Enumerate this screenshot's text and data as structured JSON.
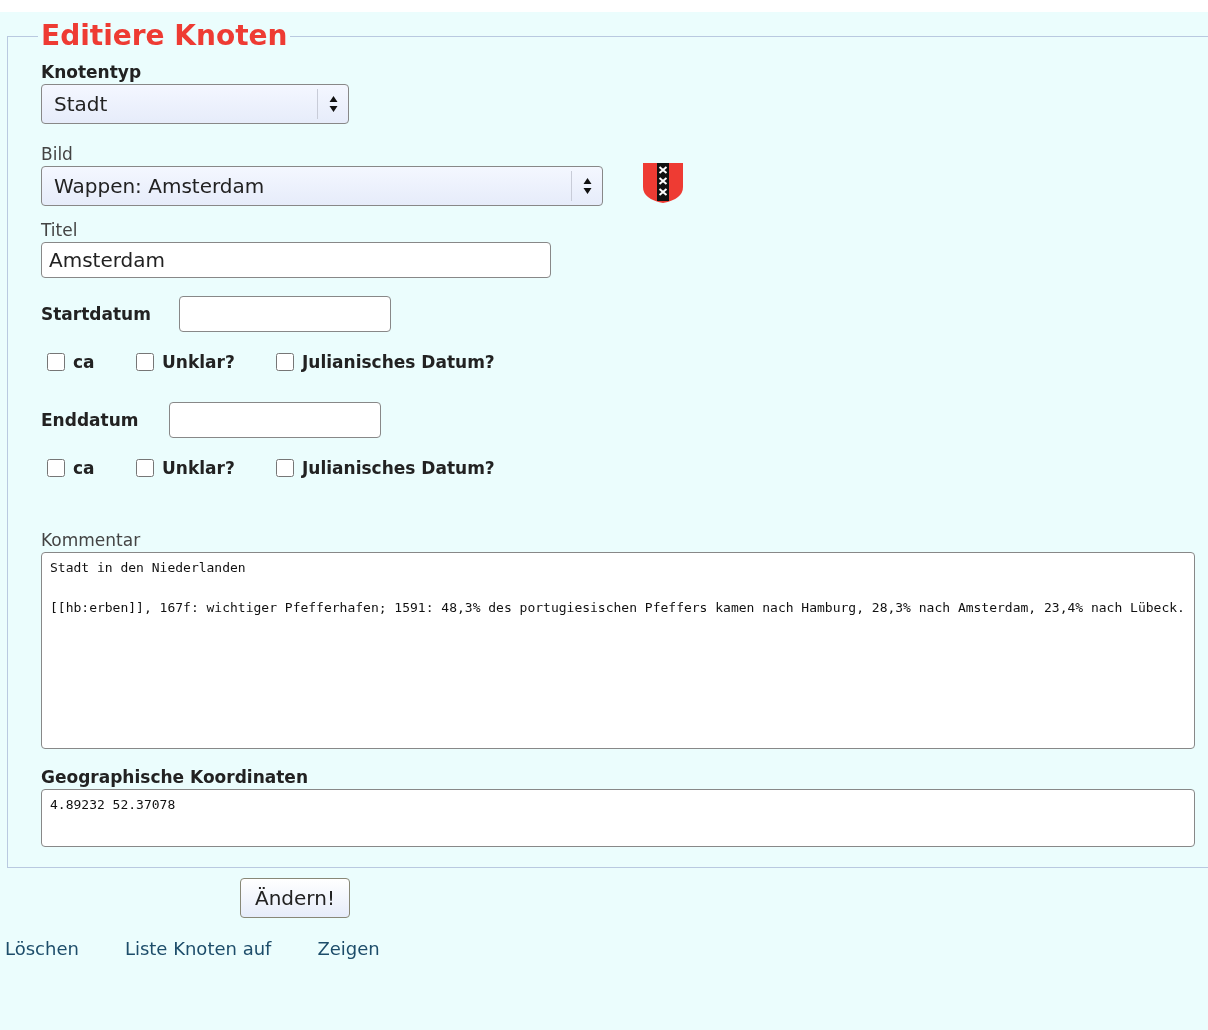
{
  "legend": "Editiere Knoten",
  "knotentyp": {
    "label": "Knotentyp",
    "value": "Stadt"
  },
  "bild": {
    "label": "Bild",
    "value": "Wappen: Amsterdam"
  },
  "titel": {
    "label": "Titel",
    "value": "Amsterdam"
  },
  "dates": [
    {
      "label": "Startdatum",
      "checkboxes": [
        {
          "label": "ca",
          "checked": false
        },
        {
          "label": "Unklar?",
          "checked": false
        },
        {
          "label": "Julianisches Datum?",
          "checked": false
        }
      ]
    },
    {
      "label": "Enddatum",
      "checkboxes": [
        {
          "label": "ca",
          "checked": false
        },
        {
          "label": "Unklar?",
          "checked": false
        },
        {
          "label": "Julianisches Datum?",
          "checked": false
        }
      ]
    }
  ],
  "kommentar": {
    "label": "Kommentar",
    "value": "Stadt in den Niederlanden\n\n[[hb:erben]], 167f: wichtiger Pfefferhafen; 1591: 48,3% des portugiesischen Pfeffers kamen nach Hamburg, 28,3% nach Amsterdam, 23,4% nach Lübeck."
  },
  "koordinaten": {
    "label": "Geographische Koordinaten",
    "value": "4.89232 52.37078"
  },
  "submit": "Ändern!",
  "links": [
    "Löschen",
    "Liste Knoten auf",
    "Zeigen"
  ]
}
